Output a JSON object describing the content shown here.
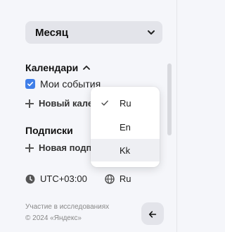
{
  "view_select": {
    "selected": "Месяц"
  },
  "calendars": {
    "title": "Календари",
    "items": [
      {
        "label": "Мои события",
        "checked": true
      }
    ],
    "add_label": "Новый календарь"
  },
  "subscriptions": {
    "title": "Подписки",
    "add_label": "Новая подписка"
  },
  "settings": {
    "timezone": "UTC+03:00",
    "language": "Ru"
  },
  "language_menu": {
    "options": [
      {
        "label": "Ru",
        "selected": true
      },
      {
        "label": "En",
        "selected": false
      },
      {
        "label": "Kk",
        "selected": false,
        "hovered": true
      }
    ]
  },
  "footer": {
    "research_link": "Участие в исследованиях",
    "copyright": "© 2024 «Яндекс»"
  },
  "colors": {
    "accent": "#3f7ee8",
    "panel_bg": "#f5f6fa",
    "control_bg": "#e3e4ea",
    "popup_bg": "#ffffff",
    "hover_bg": "#eeeff3"
  }
}
